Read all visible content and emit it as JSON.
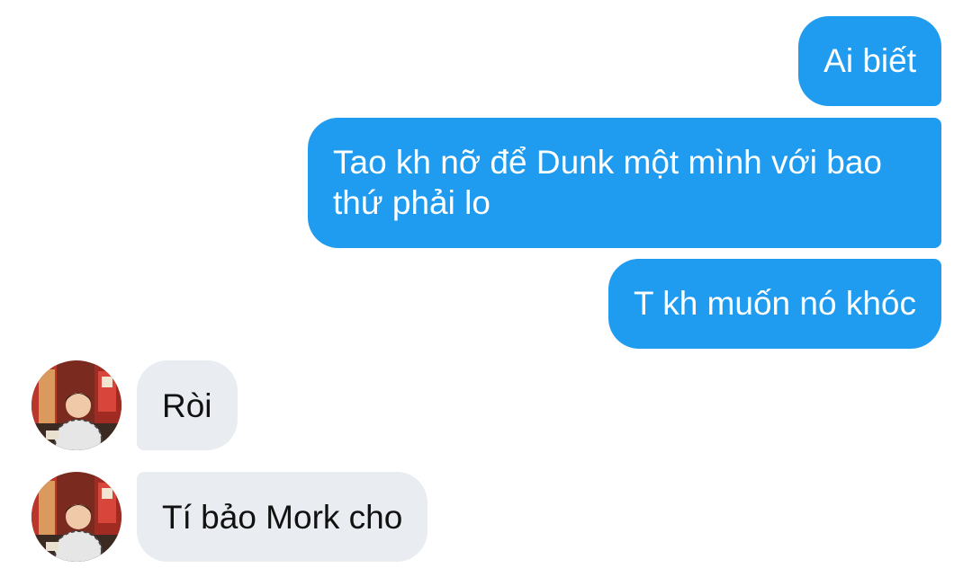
{
  "conversation": {
    "messages": [
      {
        "direction": "outgoing",
        "text": "Ai biết"
      },
      {
        "direction": "outgoing",
        "text": "Tao kh nỡ để Dunk một mình với bao thứ phải lo"
      },
      {
        "direction": "outgoing",
        "text": "T kh muốn nó khóc"
      },
      {
        "direction": "incoming",
        "text": "Ròi"
      },
      {
        "direction": "incoming",
        "text": "Tí bảo Mork cho"
      }
    ]
  },
  "colors": {
    "outgoing_bubble": "#1f9bf0",
    "incoming_bubble": "#e9edf2",
    "background": "#ffffff"
  },
  "icons": {
    "avatar": "contact-avatar-photo"
  }
}
